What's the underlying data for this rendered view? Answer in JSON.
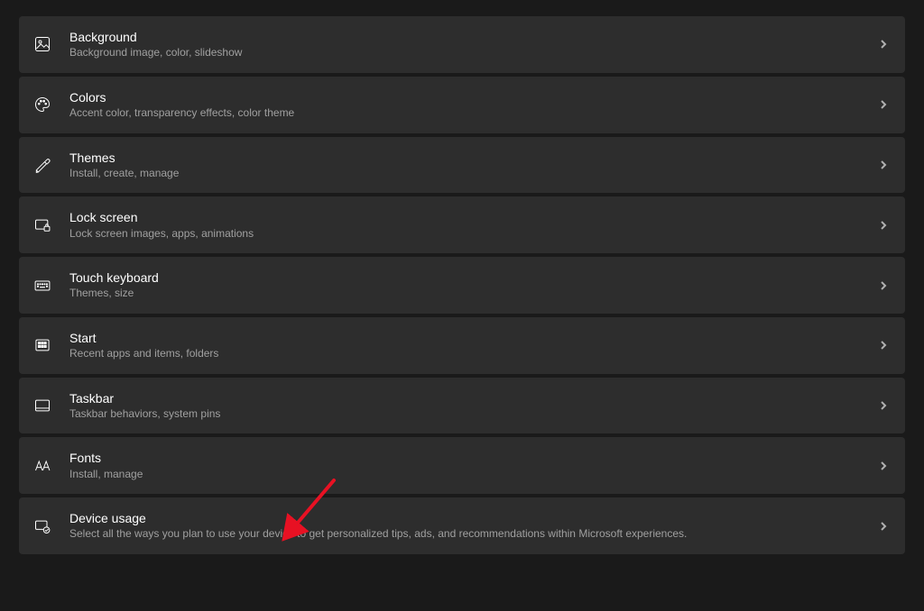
{
  "settings": [
    {
      "id": "background",
      "title": "Background",
      "desc": "Background image, color, slideshow"
    },
    {
      "id": "colors",
      "title": "Colors",
      "desc": "Accent color, transparency effects, color theme"
    },
    {
      "id": "themes",
      "title": "Themes",
      "desc": "Install, create, manage"
    },
    {
      "id": "lockscreen",
      "title": "Lock screen",
      "desc": "Lock screen images, apps, animations"
    },
    {
      "id": "touchkeyboard",
      "title": "Touch keyboard",
      "desc": "Themes, size"
    },
    {
      "id": "start",
      "title": "Start",
      "desc": "Recent apps and items, folders"
    },
    {
      "id": "taskbar",
      "title": "Taskbar",
      "desc": "Taskbar behaviors, system pins"
    },
    {
      "id": "fonts",
      "title": "Fonts",
      "desc": "Install, manage"
    },
    {
      "id": "deviceusage",
      "title": "Device usage",
      "desc": "Select all the ways you plan to use your device to get personalized tips, ads, and recommendations within Microsoft experiences."
    }
  ],
  "annotation": {
    "arrow_color": "#e81123"
  }
}
